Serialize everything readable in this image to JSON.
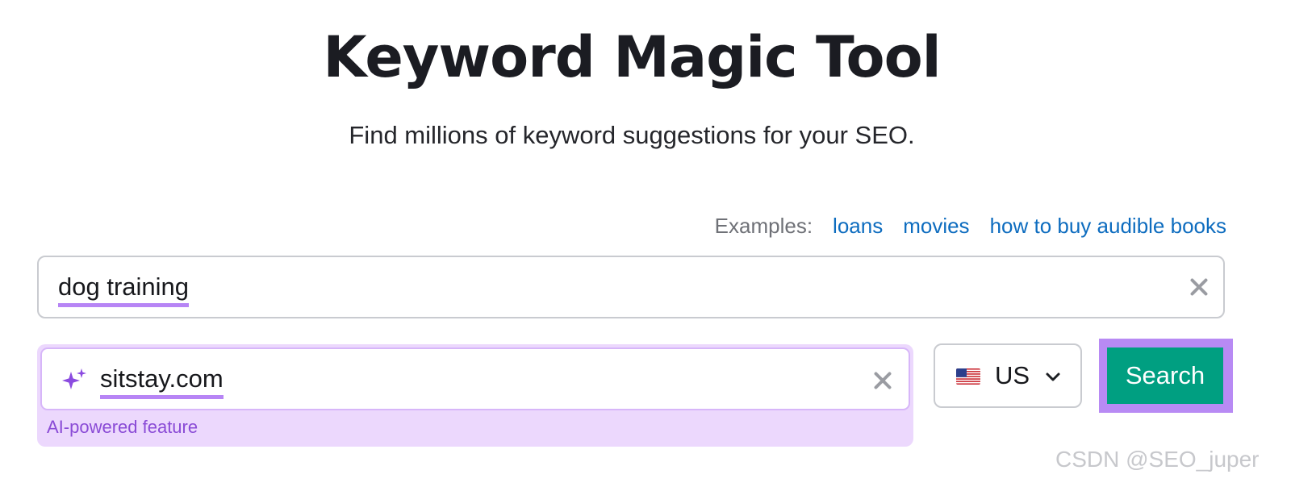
{
  "title": "Keyword Magic Tool",
  "subtitle": "Find millions of keyword suggestions for your SEO.",
  "examples": {
    "label": "Examples:",
    "links": [
      "loans",
      "movies",
      "how to buy audible books"
    ]
  },
  "keyword_input": {
    "value": "dog training",
    "clear_icon": "close-icon"
  },
  "domain_input": {
    "value": "sitstay.com",
    "icon": "sparkle-icon",
    "clear_icon": "close-icon",
    "note": "AI-powered feature"
  },
  "database_select": {
    "flag": "us-flag-icon",
    "selected": "US"
  },
  "search_button": {
    "label": "Search"
  },
  "watermark": "CSDN @SEO_juper",
  "colors": {
    "link": "#0d6cbf",
    "accent_purple": "#b785f5",
    "ai_panel_bg": "#ecd8fd",
    "search_bg": "#009f81",
    "ai_note_text": "#8a4bd6"
  }
}
